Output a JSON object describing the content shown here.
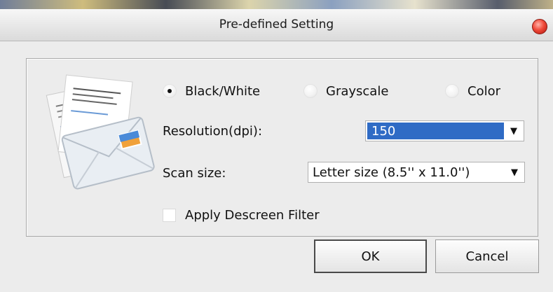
{
  "window": {
    "title": "Pre-defined Setting"
  },
  "color_mode": {
    "options": [
      {
        "label": "Black/White",
        "selected": true
      },
      {
        "label": "Grayscale",
        "selected": false
      },
      {
        "label": "Color",
        "selected": false
      }
    ]
  },
  "resolution": {
    "label": "Resolution(dpi):",
    "value": "150"
  },
  "scan_size": {
    "label": "Scan size:",
    "value": "Letter size (8.5'' x 11.0'')"
  },
  "descreen": {
    "label": "Apply Descreen Filter",
    "checked": false
  },
  "buttons": {
    "ok": "OK",
    "cancel": "Cancel"
  },
  "icons": {
    "close": "close-icon",
    "illustration": "document-envelope-icon",
    "dropdown": "chevron-down-icon"
  },
  "colors": {
    "selection": "#2f6bc5",
    "close_red": "#e0362a"
  }
}
